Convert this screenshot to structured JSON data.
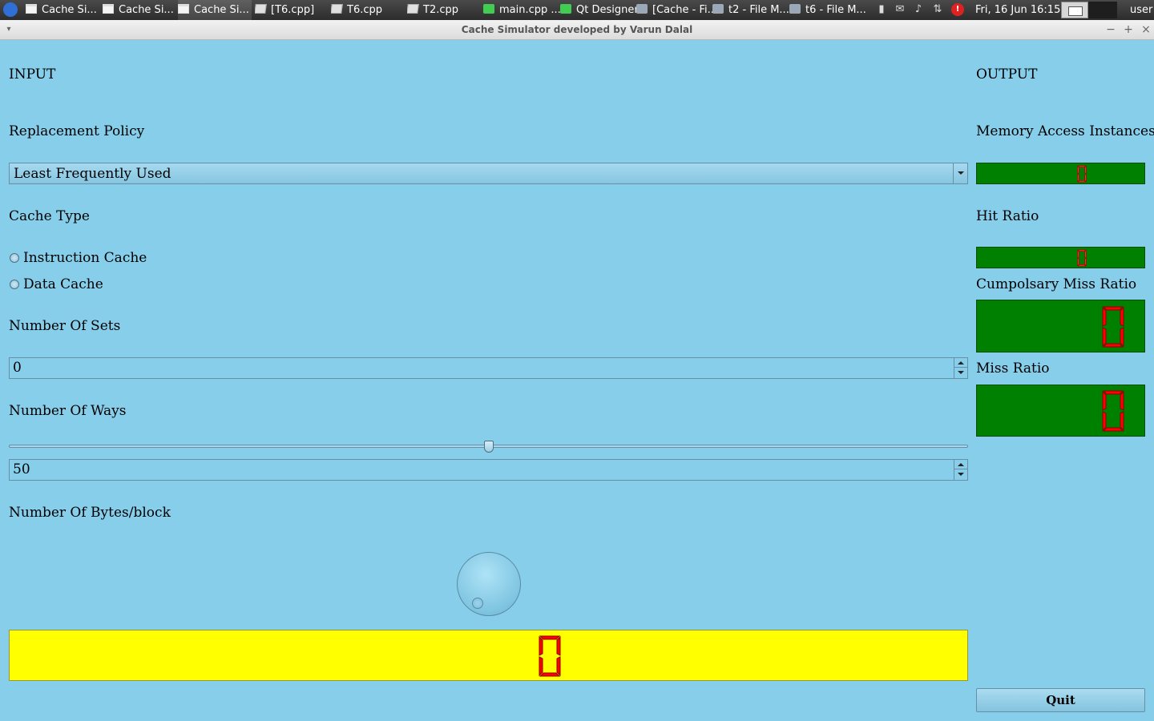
{
  "taskbar": {
    "items": [
      {
        "label": "Cache Si...",
        "icon": "window-icon"
      },
      {
        "label": "Cache Si...",
        "icon": "window-icon"
      },
      {
        "label": "Cache Si...",
        "icon": "window-icon"
      },
      {
        "label": "[T6.cpp]",
        "icon": "text-editor-icon"
      },
      {
        "label": "T6.cpp",
        "icon": "text-editor-icon"
      },
      {
        "label": "T2.cpp",
        "icon": "text-editor-icon"
      },
      {
        "label": "main.cpp ...",
        "icon": "qt-creator-icon"
      },
      {
        "label": "Qt Designer",
        "icon": "qt-designer-icon"
      },
      {
        "label": "[Cache - Fi...",
        "icon": "folder-icon"
      },
      {
        "label": "t2 - File M...",
        "icon": "folder-icon"
      },
      {
        "label": "t6 - File M...",
        "icon": "folder-icon"
      }
    ],
    "clock": "Fri, 16 Jun  16:15",
    "user": "user"
  },
  "window": {
    "title": "Cache Simulator developed by Varun Dalal"
  },
  "input": {
    "heading": "INPUT",
    "replacement_policy_label": "Replacement Policy",
    "replacement_policy_value": "Least Frequently Used",
    "cache_type_label": "Cache Type",
    "instruction_cache_label": "Instruction Cache",
    "data_cache_label": "Data Cache",
    "sets_label": "Number Of Sets",
    "sets_value": "0",
    "ways_label": "Number Of Ways",
    "ways_slider_fraction": 0.5,
    "ways_value": "50",
    "bytes_label": "Number Of Bytes/block",
    "bytes_display_value": "0"
  },
  "output": {
    "heading": "OUTPUT",
    "memory_access_label": "Memory Access Instances",
    "memory_access_value": "0",
    "hit_ratio_label": "Hit Ratio",
    "hit_ratio_value": "0",
    "compulsory_miss_label": "Cumpolsary Miss Ratio",
    "compulsory_miss_value": "0",
    "miss_ratio_label": "Miss Ratio",
    "miss_ratio_value": "0"
  },
  "quit_label": "Quit",
  "colors": {
    "background": "#87ceeb",
    "lcd_green": "#008000",
    "lcd_yellow": "#ffff00",
    "lcd_digit": "#ff0000"
  }
}
